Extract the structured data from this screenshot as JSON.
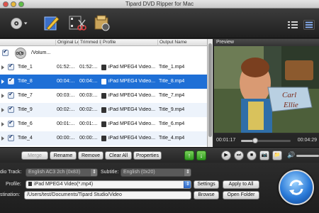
{
  "window": {
    "title": "Tipard DVD Ripper for Mac"
  },
  "toolbar": {
    "icons": [
      "load-disc-icon",
      "edit-icon",
      "clip-icon",
      "merge-icon",
      "list-view-icon",
      "grid-view-icon"
    ]
  },
  "filelist": {
    "headers": [
      "Original Le",
      "Trimmed L",
      "Profile",
      "Output Name"
    ],
    "disc": {
      "label": "/Volum...",
      "icon_text": "DVD"
    },
    "rows": [
      {
        "name": "Title_1",
        "original": "01:52:...",
        "trimmed": "01:52:...",
        "profile": "iPad MPEG4 Video...",
        "output": "Title_1.mp4",
        "selected": false
      },
      {
        "name": "Title_8",
        "original": "00:04:...",
        "trimmed": "00:04:...",
        "profile": "iPad MPEG4 Video...",
        "output": "Title_8.mp4",
        "selected": true
      },
      {
        "name": "Title_7",
        "original": "00:03:...",
        "trimmed": "00:03:...",
        "profile": "iPad MPEG4 Video...",
        "output": "Title_7.mp4",
        "selected": false
      },
      {
        "name": "Title_9",
        "original": "00:02:...",
        "trimmed": "00:02:...",
        "profile": "iPad MPEG4 Video...",
        "output": "Title_9.mp4",
        "selected": false
      },
      {
        "name": "Title_6",
        "original": "00:01:...",
        "trimmed": "00:01:...",
        "profile": "iPad MPEG4 Video...",
        "output": "Title_6.mp4",
        "selected": false
      },
      {
        "name": "Title_4",
        "original": "00:00:...",
        "trimmed": "00:00:...",
        "profile": "iPad MPEG4 Video...",
        "output": "Title_4.mp4",
        "selected": false
      }
    ]
  },
  "preview": {
    "label": "Preview",
    "current_time": "00:01:17",
    "total_time": "00:04:29",
    "progress": 0.29,
    "mailbox_text_1": "Carl",
    "mailbox_text_2": "Ellie"
  },
  "actions": {
    "merge": "Merge",
    "rename": "Rename",
    "remove": "Remove",
    "clear_all": "Clear All",
    "properties": "Properties",
    "up_arrow": "↑",
    "down_arrow": "↓"
  },
  "player": {
    "play": "▶",
    "step": "⏭",
    "stop": "■",
    "snapshot": "📷",
    "folder": "📁",
    "volume": "🔊",
    "volume_level": 0.6
  },
  "settings": {
    "audio_track_label": "dio Track:",
    "audio_track_value": "English AC3 2ch (0x83)",
    "subtitle_label": "Subtitle:",
    "subtitle_value": "English (0x20)",
    "profile_label": "Profile:",
    "profile_value": "iPad MPEG4 Video(*.mp4)",
    "destination_label": "stination:",
    "destination_value": "/Users/test/Documents/Tipard Studio/Video",
    "settings_button": "Settings",
    "apply_all_button": "Apply to All",
    "browse_button": "Browse",
    "open_folder_button": "Open Folder"
  },
  "colors": {
    "selection": "#1e6fd6",
    "convert": "#2a7ad8",
    "arrows": "#2f9a1f"
  }
}
